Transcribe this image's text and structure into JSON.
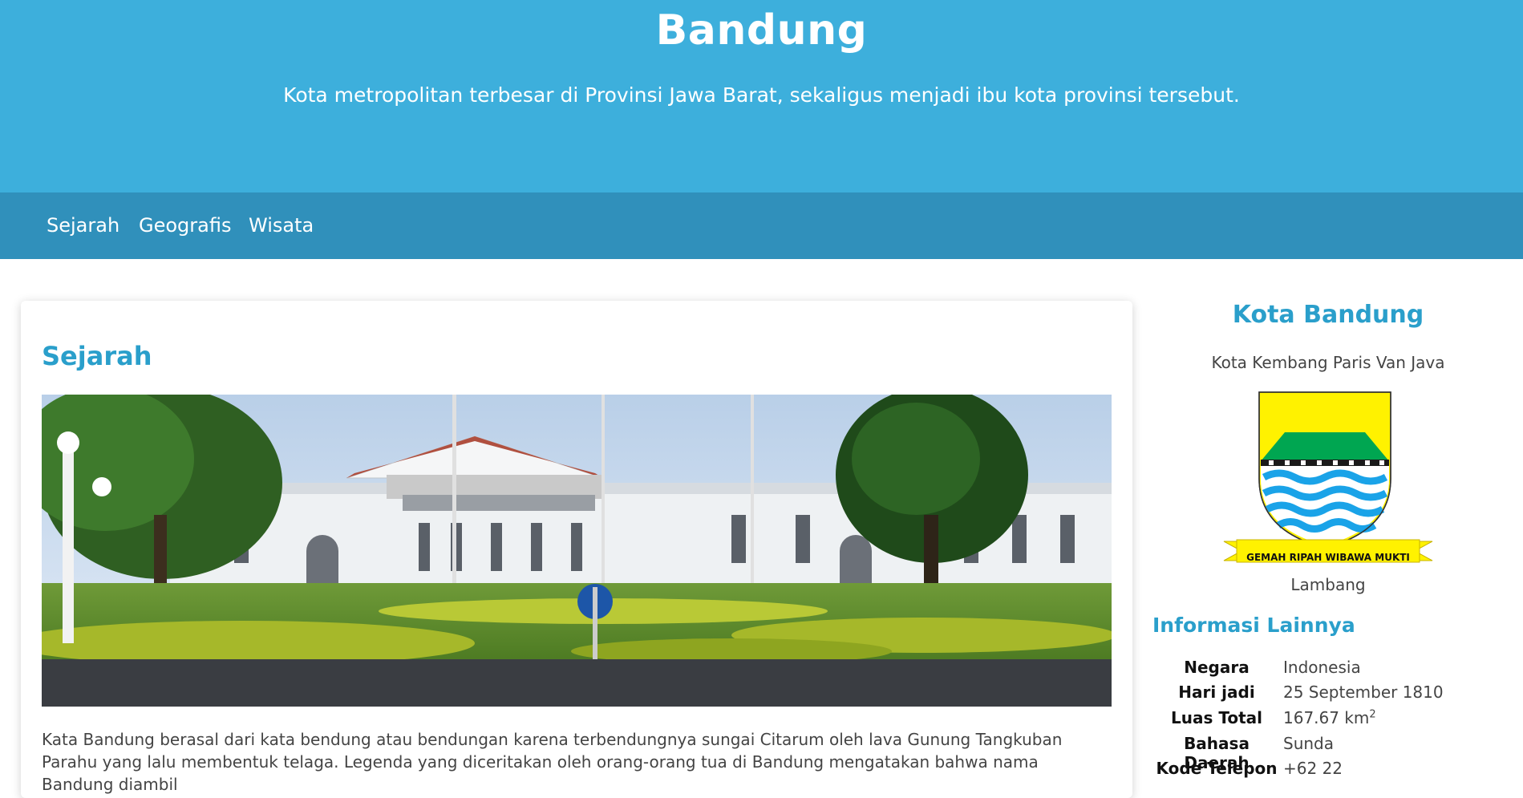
{
  "header": {
    "title": "Bandung",
    "subtitle": "Kota metropolitan terbesar di Provinsi Jawa Barat, sekaligus menjadi ibu kota provinsi tersebut."
  },
  "nav": {
    "items": [
      {
        "label": "Sejarah"
      },
      {
        "label": "Geografis"
      },
      {
        "label": "Wisata"
      }
    ]
  },
  "article": {
    "heading": "Sejarah",
    "text": "Kata Bandung berasal dari kata bendung atau bendungan karena terbendungnya sungai Citarum oleh lava Gunung Tangkuban Parahu yang lalu membentuk telaga. Legenda yang diceritakan oleh orang-orang tua di Bandung mengatakan bahwa nama Bandung diambil"
  },
  "sidebar": {
    "title": "Kota Bandung",
    "subtitle": "Kota Kembang Paris Van Java",
    "emblem_motto": "GEMAH RIPAH WIBAWA MUKTI",
    "emblem_caption": "Lambang",
    "info_heading": "Informasi Lainnya",
    "info": [
      {
        "key": "Negara",
        "value": "Indonesia"
      },
      {
        "key": "Hari jadi",
        "value": "25 September 1810"
      },
      {
        "key": "Luas Total",
        "value": "167.67 km",
        "sup": "2"
      },
      {
        "key": "Bahasa Daerah",
        "value": "Sunda"
      },
      {
        "key": "Kode Telepon",
        "value": "+62 22"
      }
    ]
  },
  "colors": {
    "header_bg": "#3dafdc",
    "nav_bg": "#3090bb",
    "accent": "#2a9fcb"
  }
}
